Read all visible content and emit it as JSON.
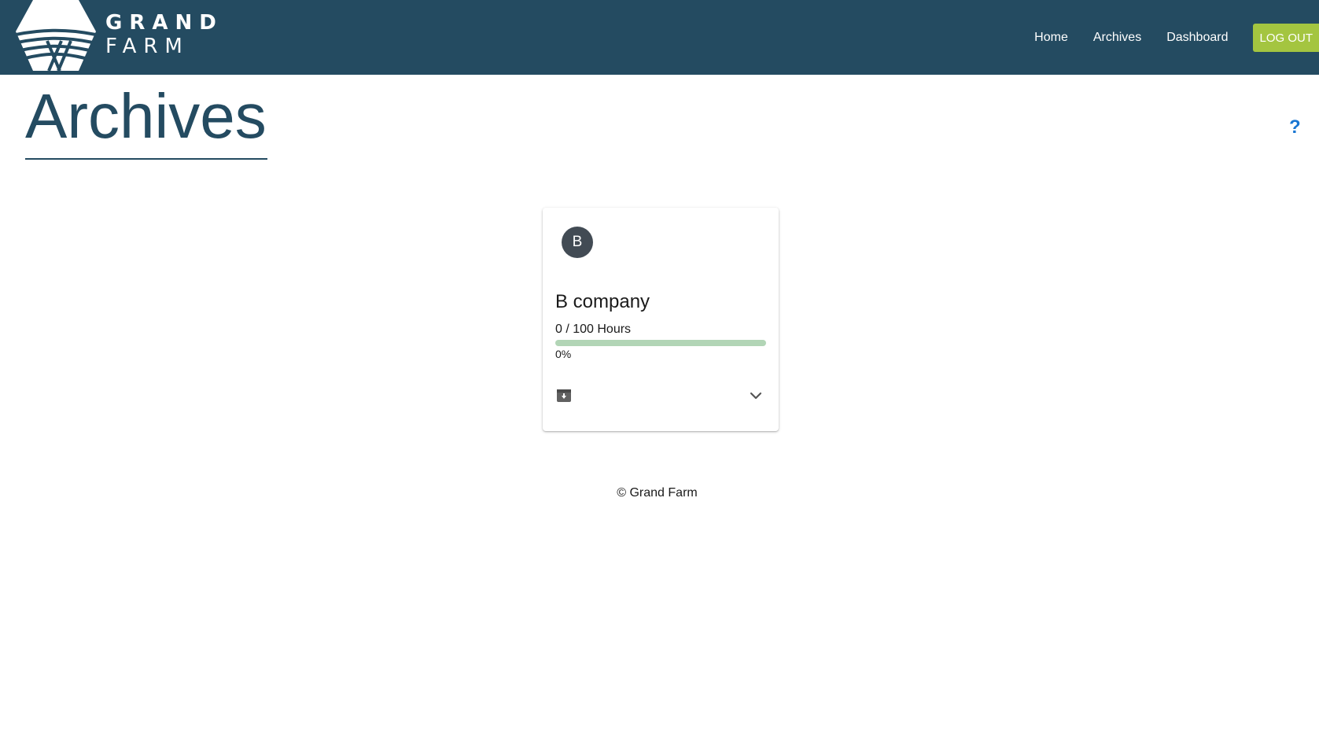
{
  "brand": {
    "line1": "GRAND",
    "line2": "FARM",
    "color": "#244b61",
    "accent": "#a4c540",
    "logo_icon": "grand-farm-logo-icon"
  },
  "nav": {
    "items": [
      {
        "label": "Home"
      },
      {
        "label": "Archives"
      },
      {
        "label": "Dashboard"
      }
    ],
    "logout_label": "LOG OUT"
  },
  "page": {
    "title": "Archives",
    "help_label": "?"
  },
  "cards": [
    {
      "avatar_letter": "B",
      "name": "B company",
      "hours_text": "0 / 100 Hours",
      "progress_percent": 0,
      "percent_text": "0%",
      "archive_icon": "unarchive-icon",
      "expand_icon": "chevron-down-icon"
    }
  ],
  "footer": {
    "text": "© Grand Farm"
  }
}
